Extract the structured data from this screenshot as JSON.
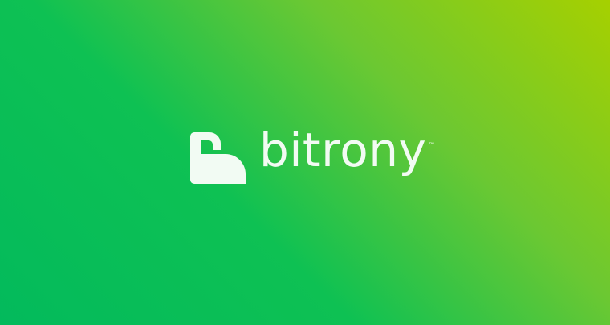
{
  "brand": {
    "name": "bitrony",
    "trademark": "™",
    "icon": "bitrony-lock-b-icon",
    "colors": {
      "logo": "#f2fbf3",
      "gradient_top_right": "#a6d000",
      "gradient_middle": "#6cc832",
      "gradient_bottom_left": "#03ba5c"
    }
  }
}
